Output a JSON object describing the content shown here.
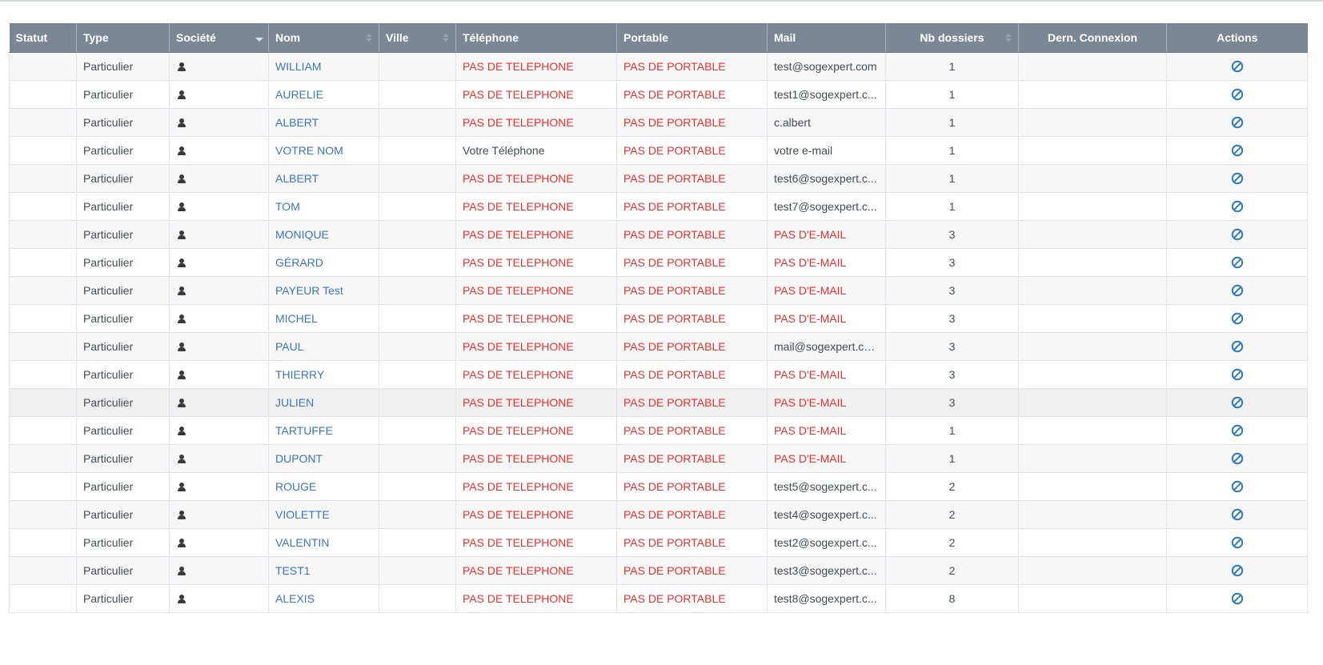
{
  "table": {
    "columns": [
      {
        "key": "statut",
        "label": "Statut",
        "sort": "none"
      },
      {
        "key": "type",
        "label": "Type",
        "sort": "none"
      },
      {
        "key": "societe",
        "label": "Société",
        "sort": "desc"
      },
      {
        "key": "nom",
        "label": "Nom",
        "sort": "both"
      },
      {
        "key": "ville",
        "label": "Ville",
        "sort": "both"
      },
      {
        "key": "telephone",
        "label": "Téléphone",
        "sort": "none"
      },
      {
        "key": "portable",
        "label": "Portable",
        "sort": "none"
      },
      {
        "key": "mail",
        "label": "Mail",
        "sort": "none"
      },
      {
        "key": "nb_dossiers",
        "label": "Nb dossiers",
        "sort": "both"
      },
      {
        "key": "dern_connexion",
        "label": "Dern. Connexion",
        "sort": "none"
      },
      {
        "key": "actions",
        "label": "Actions",
        "sort": "none"
      }
    ],
    "societe_icon": "user-icon",
    "action_icon": "ban-icon",
    "missing_color": "#e8312f",
    "link_color": "#3d76b6",
    "action_color": "#2f7bbf",
    "rows": [
      {
        "statut": "",
        "type": "Particulier",
        "nom": "WILLIAM",
        "ville": "",
        "telephone": "PAS DE TELEPHONE",
        "telephone_missing": true,
        "portable": "PAS DE PORTABLE",
        "portable_missing": true,
        "mail": "test@sogexpert.com",
        "mail_missing": false,
        "nb_dossiers": "1",
        "dern_connexion": ""
      },
      {
        "statut": "",
        "type": "Particulier",
        "nom": "AURELIE",
        "ville": "",
        "telephone": "PAS DE TELEPHONE",
        "telephone_missing": true,
        "portable": "PAS DE PORTABLE",
        "portable_missing": true,
        "mail": "test1@sogexpert.c...",
        "mail_missing": false,
        "nb_dossiers": "1",
        "dern_connexion": ""
      },
      {
        "statut": "",
        "type": "Particulier",
        "nom": "ALBERT",
        "ville": "",
        "telephone": "PAS DE TELEPHONE",
        "telephone_missing": true,
        "portable": "PAS DE PORTABLE",
        "portable_missing": true,
        "mail": "c.albert",
        "mail_missing": false,
        "nb_dossiers": "1",
        "dern_connexion": ""
      },
      {
        "statut": "",
        "type": "Particulier",
        "nom": "VOTRE NOM",
        "ville": "",
        "telephone": "Votre Téléphone",
        "telephone_missing": false,
        "portable": "PAS DE PORTABLE",
        "portable_missing": true,
        "mail": "votre e-mail",
        "mail_missing": false,
        "nb_dossiers": "1",
        "dern_connexion": ""
      },
      {
        "statut": "",
        "type": "Particulier",
        "nom": "ALBERT",
        "ville": "",
        "telephone": "PAS DE TELEPHONE",
        "telephone_missing": true,
        "portable": "PAS DE PORTABLE",
        "portable_missing": true,
        "mail": "test6@sogexpert.c...",
        "mail_missing": false,
        "nb_dossiers": "1",
        "dern_connexion": ""
      },
      {
        "statut": "",
        "type": "Particulier",
        "nom": "TOM",
        "ville": "",
        "telephone": "PAS DE TELEPHONE",
        "telephone_missing": true,
        "portable": "PAS DE PORTABLE",
        "portable_missing": true,
        "mail": "test7@sogexpert.c...",
        "mail_missing": false,
        "nb_dossiers": "1",
        "dern_connexion": ""
      },
      {
        "statut": "",
        "type": "Particulier",
        "nom": "MONIQUE",
        "ville": "",
        "telephone": "PAS DE TELEPHONE",
        "telephone_missing": true,
        "portable": "PAS DE PORTABLE",
        "portable_missing": true,
        "mail": "PAS D'E-MAIL",
        "mail_missing": true,
        "nb_dossiers": "3",
        "dern_connexion": ""
      },
      {
        "statut": "",
        "type": "Particulier",
        "nom": "GÉRARD",
        "ville": "",
        "telephone": "PAS DE TELEPHONE",
        "telephone_missing": true,
        "portable": "PAS DE PORTABLE",
        "portable_missing": true,
        "mail": "PAS D'E-MAIL",
        "mail_missing": true,
        "nb_dossiers": "3",
        "dern_connexion": ""
      },
      {
        "statut": "",
        "type": "Particulier",
        "nom": "PAYEUR Test",
        "ville": "",
        "telephone": "PAS DE TELEPHONE",
        "telephone_missing": true,
        "portable": "PAS DE PORTABLE",
        "portable_missing": true,
        "mail": "PAS D'E-MAIL",
        "mail_missing": true,
        "nb_dossiers": "3",
        "dern_connexion": ""
      },
      {
        "statut": "",
        "type": "Particulier",
        "nom": "MICHEL",
        "ville": "",
        "telephone": "PAS DE TELEPHONE",
        "telephone_missing": true,
        "portable": "PAS DE PORTABLE",
        "portable_missing": true,
        "mail": "PAS D'E-MAIL",
        "mail_missing": true,
        "nb_dossiers": "3",
        "dern_connexion": ""
      },
      {
        "statut": "",
        "type": "Particulier",
        "nom": "PAUL",
        "ville": "",
        "telephone": "PAS DE TELEPHONE",
        "telephone_missing": true,
        "portable": "PAS DE PORTABLE",
        "portable_missing": true,
        "mail": "mail@sogexpert.com",
        "mail_missing": false,
        "nb_dossiers": "3",
        "dern_connexion": ""
      },
      {
        "statut": "",
        "type": "Particulier",
        "nom": "THIERRY",
        "ville": "",
        "telephone": "PAS DE TELEPHONE",
        "telephone_missing": true,
        "portable": "PAS DE PORTABLE",
        "portable_missing": true,
        "mail": "PAS D'E-MAIL",
        "mail_missing": true,
        "nb_dossiers": "3",
        "dern_connexion": ""
      },
      {
        "statut": "",
        "type": "Particulier",
        "nom": "JULIEN",
        "ville": "",
        "telephone": "PAS DE TELEPHONE",
        "telephone_missing": true,
        "portable": "PAS DE PORTABLE",
        "portable_missing": true,
        "mail": "PAS D'E-MAIL",
        "mail_missing": true,
        "nb_dossiers": "3",
        "dern_connexion": ""
      },
      {
        "statut": "",
        "type": "Particulier",
        "nom": "TARTUFFE",
        "ville": "",
        "telephone": "PAS DE TELEPHONE",
        "telephone_missing": true,
        "portable": "PAS DE PORTABLE",
        "portable_missing": true,
        "mail": "PAS D'E-MAIL",
        "mail_missing": true,
        "nb_dossiers": "1",
        "dern_connexion": ""
      },
      {
        "statut": "",
        "type": "Particulier",
        "nom": "DUPONT",
        "ville": "",
        "telephone": "PAS DE TELEPHONE",
        "telephone_missing": true,
        "portable": "PAS DE PORTABLE",
        "portable_missing": true,
        "mail": "PAS D'E-MAIL",
        "mail_missing": true,
        "nb_dossiers": "1",
        "dern_connexion": ""
      },
      {
        "statut": "",
        "type": "Particulier",
        "nom": "ROUGE",
        "ville": "",
        "telephone": "PAS DE TELEPHONE",
        "telephone_missing": true,
        "portable": "PAS DE PORTABLE",
        "portable_missing": true,
        "mail": "test5@sogexpert.c...",
        "mail_missing": false,
        "nb_dossiers": "2",
        "dern_connexion": ""
      },
      {
        "statut": "",
        "type": "Particulier",
        "nom": "VIOLETTE",
        "ville": "",
        "telephone": "PAS DE TELEPHONE",
        "telephone_missing": true,
        "portable": "PAS DE PORTABLE",
        "portable_missing": true,
        "mail": "test4@sogexpert.c...",
        "mail_missing": false,
        "nb_dossiers": "2",
        "dern_connexion": ""
      },
      {
        "statut": "",
        "type": "Particulier",
        "nom": "VALENTIN",
        "ville": "",
        "telephone": "PAS DE TELEPHONE",
        "telephone_missing": true,
        "portable": "PAS DE PORTABLE",
        "portable_missing": true,
        "mail": "test2@sogexpert.c...",
        "mail_missing": false,
        "nb_dossiers": "2",
        "dern_connexion": ""
      },
      {
        "statut": "",
        "type": "Particulier",
        "nom": "TEST1",
        "ville": "",
        "telephone": "PAS DE TELEPHONE",
        "telephone_missing": true,
        "portable": "PAS DE PORTABLE",
        "portable_missing": true,
        "mail": "test3@sogexpert.c...",
        "mail_missing": false,
        "nb_dossiers": "2",
        "dern_connexion": ""
      },
      {
        "statut": "",
        "type": "Particulier",
        "nom": "ALEXIS",
        "ville": "",
        "telephone": "PAS DE TELEPHONE",
        "telephone_missing": true,
        "portable": "PAS DE PORTABLE",
        "portable_missing": true,
        "mail": "test8@sogexpert.c...",
        "mail_missing": false,
        "nb_dossiers": "8",
        "dern_connexion": ""
      }
    ]
  }
}
